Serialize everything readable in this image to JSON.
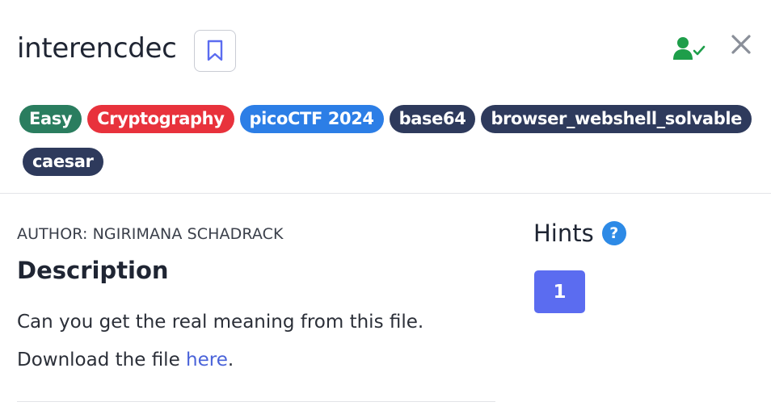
{
  "challenge": {
    "title": "interencdec",
    "author": "AUTHOR: NGIRIMANA SCHADRACK",
    "description_heading": "Description",
    "description": "Can you get the real meaning from this file.",
    "download_prefix": "Download the file ",
    "download_link": "here",
    "download_suffix": "."
  },
  "tags": [
    {
      "label": "Easy",
      "color": "#2a7d5f"
    },
    {
      "label": "Cryptography",
      "color": "#e8323c"
    },
    {
      "label": "picoCTF 2024",
      "color": "#2c7ee6"
    },
    {
      "label": "base64",
      "color": "#2e3a5c"
    },
    {
      "label": "browser_webshell_solvable",
      "color": "#2e3a5c"
    },
    {
      "label": "caesar",
      "color": "#2e3a5c"
    }
  ],
  "hints": {
    "title": "Hints",
    "help_icon": "?",
    "items": [
      "1"
    ]
  },
  "icons": {
    "bookmark": "bookmark-icon",
    "solved": "user-check-icon",
    "close": "close-icon"
  },
  "colors": {
    "accent": "#5b6cf0",
    "solved": "#1e9e4a",
    "link": "#4a63d9"
  }
}
